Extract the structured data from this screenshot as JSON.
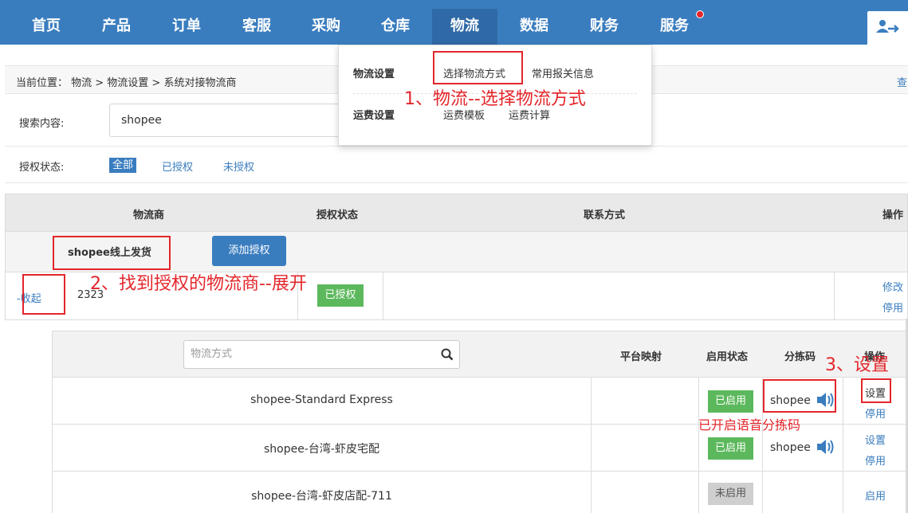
{
  "nav": {
    "items": [
      "首页",
      "产品",
      "订单",
      "客服",
      "采购",
      "仓库",
      "物流",
      "数据",
      "财务",
      "服务"
    ],
    "active": "物流"
  },
  "dropdown": {
    "group1_title": "物流设置",
    "group1_links": [
      "选择物流方式",
      "常用报关信息"
    ],
    "group2_title": "运费设置",
    "group2_links": [
      "运费模板",
      "运费计算"
    ]
  },
  "breadcrumb": {
    "text": "当前位置： 物流 > 物流设置 > 系统对接物流商",
    "right_link": "查"
  },
  "search": {
    "label": "搜索内容:",
    "value": "shopee"
  },
  "auth_filter": {
    "label": "授权状态:",
    "options": [
      "全部",
      "已授权",
      "未授权"
    ],
    "selected": "全部"
  },
  "table": {
    "headers": [
      "物流商",
      "授权状态",
      "联系方式",
      "操作"
    ],
    "group_name": "shopee线上发货",
    "add_auth_button": "添加授权",
    "provider_row": {
      "collapse_link": "-收起",
      "account": "2323",
      "status": "已授权",
      "ops": [
        "修改",
        "停用"
      ]
    }
  },
  "subtable": {
    "search_placeholder": "物流方式",
    "headers": [
      "平台映射",
      "启用状态",
      "分拣码",
      "操作"
    ],
    "rows": [
      {
        "name": "shopee-Standard Express",
        "status": "已启用",
        "sort_code": "shopee",
        "ops": [
          "设置",
          "停用"
        ]
      },
      {
        "name": "shopee-台湾-虾皮宅配",
        "status": "已启用",
        "sort_code": "shopee",
        "ops": [
          "设置",
          "停用"
        ]
      },
      {
        "name": "shopee-台湾-虾皮店配-711",
        "status": "未启用",
        "sort_code": "",
        "ops": [
          "启用"
        ]
      }
    ]
  },
  "annotations": {
    "step1": "1、物流--选择物流方式",
    "step2": "2、找到授权的物流商--展开",
    "step3": "3、设置",
    "voice_note": "已开启语音分拣码"
  },
  "colors": {
    "nav_bg": "#3a7dbf",
    "link": "#3a7dbf",
    "enabled_badge": "#5cb85c",
    "disabled_badge": "#cfcfcf",
    "annotation": "#e3262b"
  },
  "icons": [
    "user-exchange-icon",
    "search-icon",
    "speaker-icon"
  ]
}
